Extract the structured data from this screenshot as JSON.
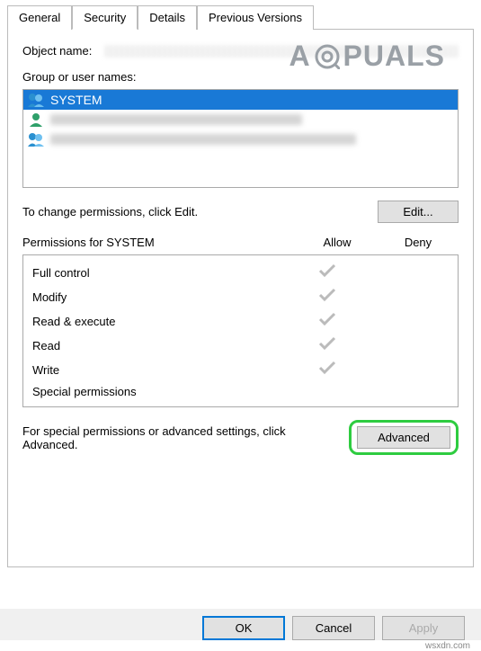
{
  "tabs": {
    "general": "General",
    "security": "Security",
    "details": "Details",
    "previous": "Previous Versions"
  },
  "object": {
    "label": "Object name:"
  },
  "group": {
    "label": "Group or user names:",
    "system": "SYSTEM"
  },
  "edit": {
    "text": "To change permissions, click Edit.",
    "button": "Edit..."
  },
  "permissions": {
    "header": "Permissions for SYSTEM",
    "allow": "Allow",
    "deny": "Deny",
    "rows": {
      "full": "Full control",
      "modify": "Modify",
      "readexec": "Read & execute",
      "read": "Read",
      "write": "Write",
      "special": "Special permissions"
    }
  },
  "advanced": {
    "text": "For special permissions or advanced settings, click Advanced.",
    "button": "Advanced"
  },
  "buttons": {
    "ok": "OK",
    "cancel": "Cancel",
    "apply": "Apply"
  },
  "watermark": {
    "brand_left": "A",
    "brand_right": "PUALS",
    "url": "wsxdn.com"
  }
}
